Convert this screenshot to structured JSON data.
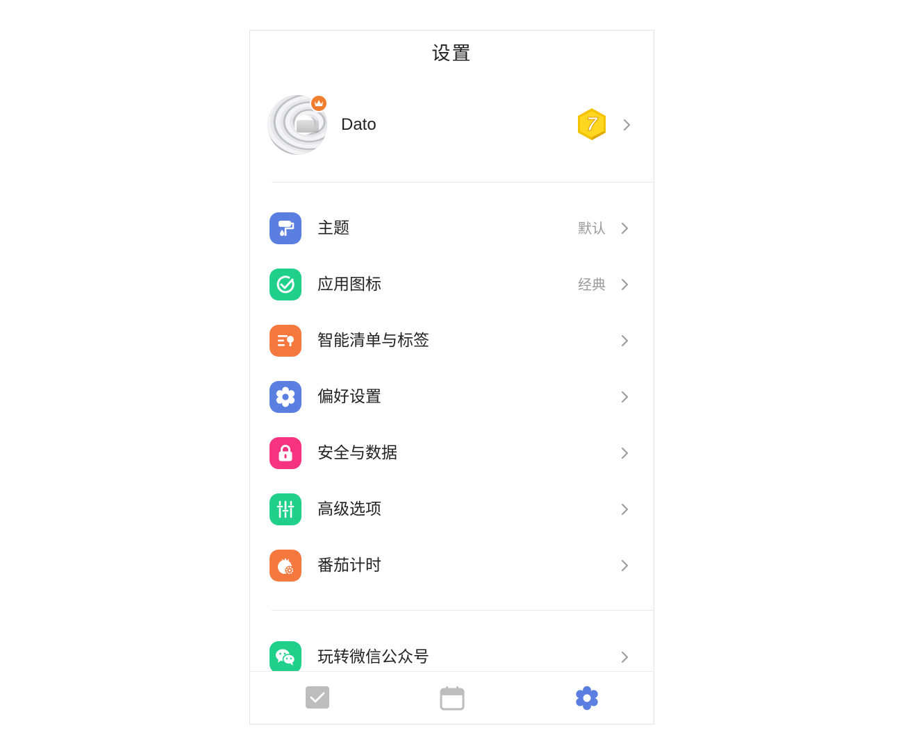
{
  "header": {
    "title": "设置"
  },
  "profile": {
    "username": "Dato",
    "level": "7"
  },
  "colors": {
    "theme": "#5b7fe0",
    "app_icon": "#1fcf8a",
    "smart_list": "#f5793f",
    "preferences": "#5b7fe0",
    "security": "#f5337f",
    "advanced": "#1fcf8a",
    "pomodoro": "#f5793f",
    "wechat": "#1fcf8a",
    "tab_active": "#5b7fe0",
    "tab_inactive": "#bdbdbd"
  },
  "settings": {
    "items": [
      {
        "label": "主题",
        "value": "默认",
        "icon": "paint-roller-icon"
      },
      {
        "label": "应用图标",
        "value": "经典",
        "icon": "check-circle-icon"
      },
      {
        "label": "智能清单与标签",
        "value": "",
        "icon": "smart-list-icon"
      },
      {
        "label": "偏好设置",
        "value": "",
        "icon": "gear-icon"
      },
      {
        "label": "安全与数据",
        "value": "",
        "icon": "lock-icon"
      },
      {
        "label": "高级选项",
        "value": "",
        "icon": "sliders-icon"
      },
      {
        "label": "番茄计时",
        "value": "",
        "icon": "tomato-timer-icon"
      }
    ],
    "extra": [
      {
        "label": "玩转微信公众号",
        "value": "",
        "icon": "wechat-icon"
      }
    ]
  },
  "tabbar": {
    "tabs": [
      {
        "name": "tasks",
        "icon": "checkbox-icon",
        "active": false
      },
      {
        "name": "calendar",
        "icon": "calendar-icon",
        "active": false
      },
      {
        "name": "settings",
        "icon": "gear-icon",
        "active": true
      }
    ]
  }
}
